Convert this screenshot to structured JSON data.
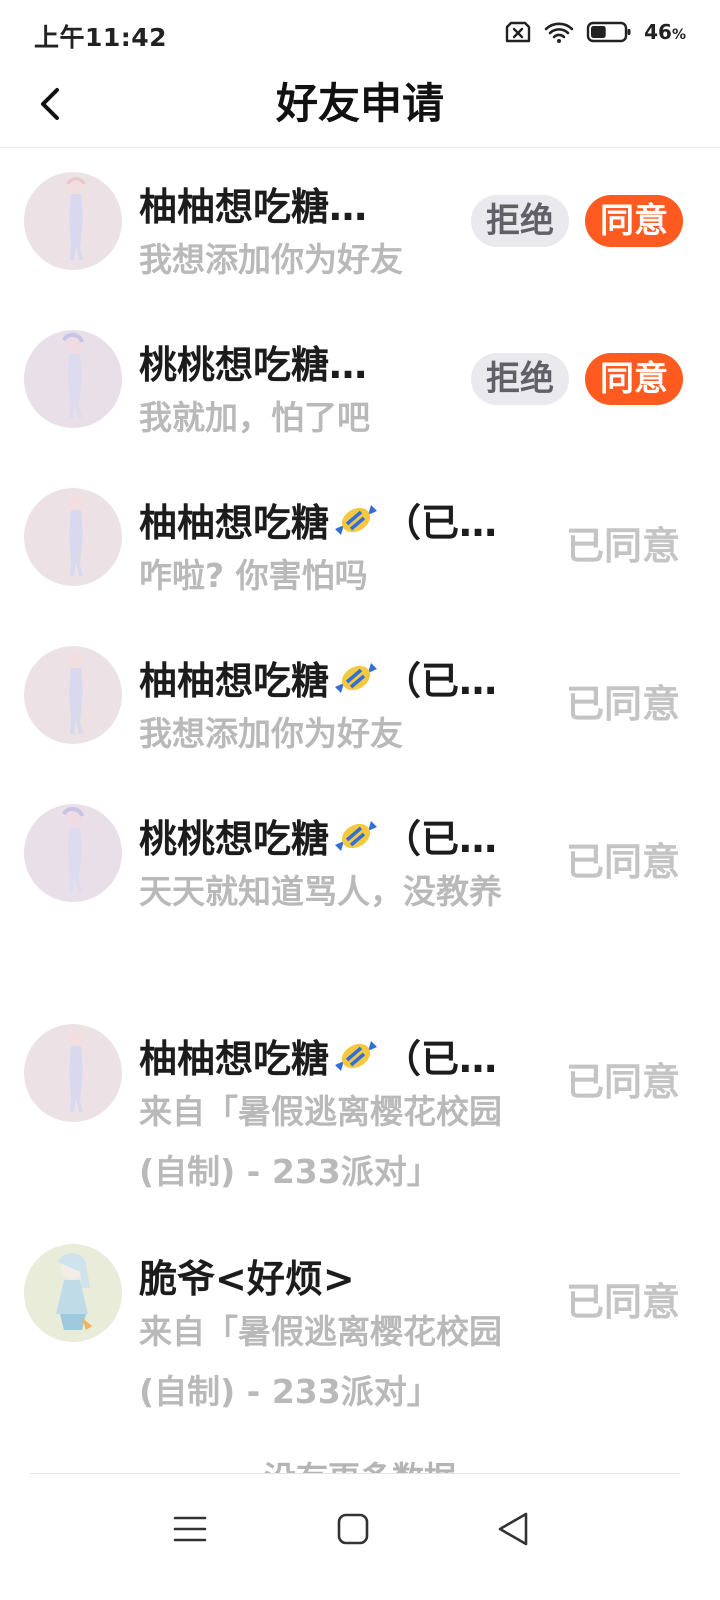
{
  "status_bar": {
    "time": "上午11:42",
    "battery_percent": "46",
    "battery_unit": "%",
    "battery_level": 0.46,
    "icons": [
      "no-sim-icon",
      "wifi-icon",
      "battery-icon"
    ]
  },
  "header": {
    "title": "好友申请",
    "back_icon": "chevron-left-icon"
  },
  "requests": [
    {
      "name": "柚柚想吃糖…",
      "message": "我想添加你为好友",
      "state": "pending",
      "reject_label": "拒绝",
      "accept_label": "同意"
    },
    {
      "name": "桃桃想吃糖…",
      "message": "我就加，怕了吧",
      "state": "pending",
      "reject_label": "拒绝",
      "accept_label": "同意"
    },
    {
      "name_prefix": "柚柚想吃糖",
      "name_suffix": "（已…",
      "message": "咋啦? 你害怕吗",
      "state": "accepted",
      "status_label": "已同意"
    },
    {
      "name_prefix": "柚柚想吃糖",
      "name_suffix": "（已…",
      "message": "我想添加你为好友",
      "state": "accepted",
      "status_label": "已同意"
    },
    {
      "name_prefix": "桃桃想吃糖",
      "name_suffix": "（已…",
      "message": "天天就知道骂人，没教养",
      "state": "accepted",
      "status_label": "已同意"
    },
    {
      "name_prefix": "柚柚想吃糖",
      "name_suffix": "（已…",
      "message": "来自「暑假逃离樱花校园(自制) - 233派对」",
      "state": "accepted",
      "status_label": "已同意"
    },
    {
      "name": "脆爷<好烦>",
      "message": "来自「暑假逃离樱花校园(自制) - 233派对」",
      "state": "accepted",
      "status_label": "已同意"
    }
  ],
  "footer": {
    "no_more_text": "没有更多数据"
  },
  "nav": {
    "icons": [
      "menu-icon",
      "home-square-icon",
      "back-triangle-icon"
    ]
  },
  "colors": {
    "accent": "#ff5a1f",
    "reject_bg": "#eaeaee",
    "muted_text": "#b9b9b9",
    "accepted_text": "#c4c4c4"
  }
}
